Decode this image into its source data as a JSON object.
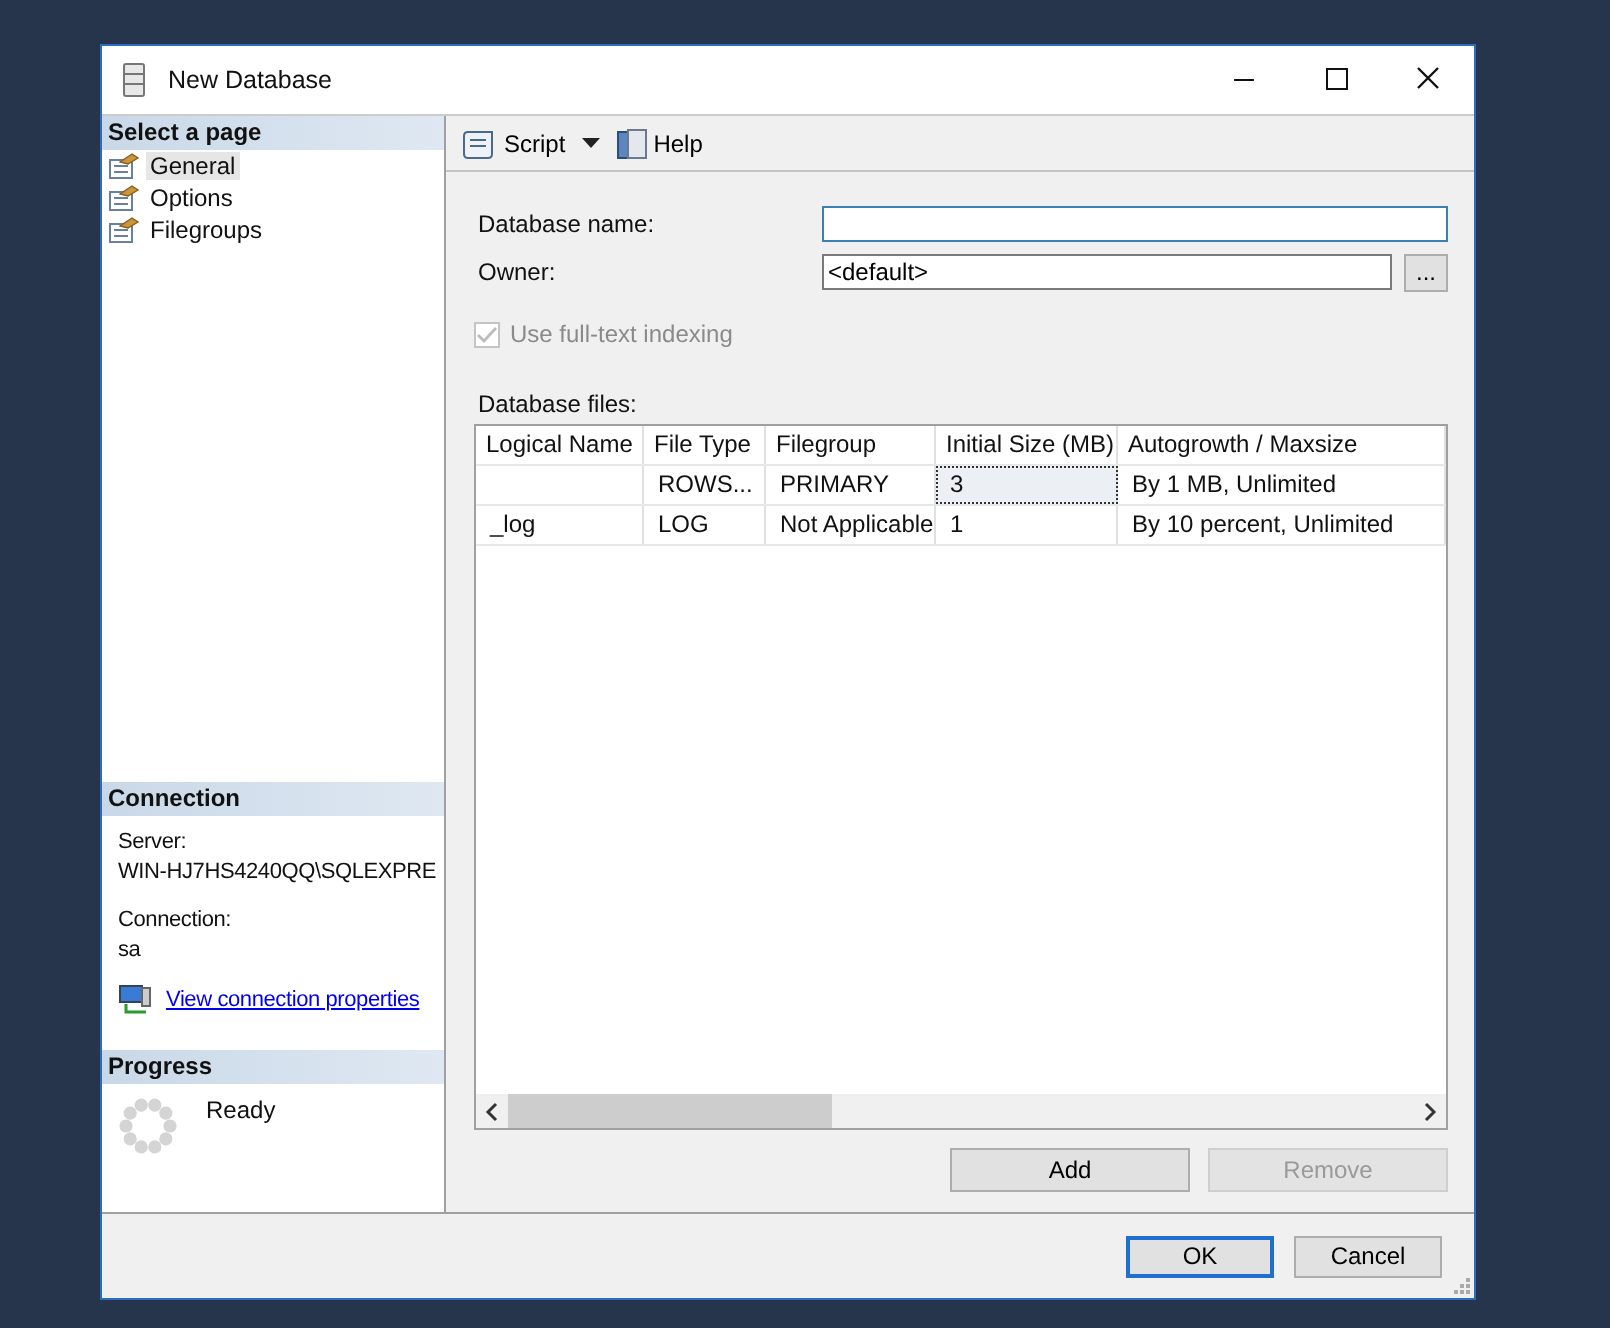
{
  "window": {
    "title": "New Database"
  },
  "sidebar": {
    "heading": "Select a page",
    "items": [
      {
        "label": "General",
        "selected": true
      },
      {
        "label": "Options",
        "selected": false
      },
      {
        "label": "Filegroups",
        "selected": false
      }
    ]
  },
  "connection": {
    "heading": "Connection",
    "server_label": "Server:",
    "server": "WIN-HJ7HS4240QQ\\SQLEXPRE",
    "connection_label": "Connection:",
    "connection": "sa",
    "link": "View connection properties"
  },
  "progress": {
    "heading": "Progress",
    "status": "Ready"
  },
  "toolbar": {
    "items": [
      {
        "label": "Script",
        "kind": "script"
      },
      {
        "label": "Help",
        "kind": "help"
      }
    ]
  },
  "form": {
    "name_label": "Database name:",
    "name_focused": true,
    "owner_label": "Owner:",
    "owner_value": "<default>",
    "browse": "...",
    "fulltext": {
      "label": "Use full-text indexing",
      "checked": true,
      "disabled": true
    }
  },
  "files": {
    "label": "Database files:",
    "columns": [
      "Logical Name",
      "File Type",
      "Filegroup",
      "Initial Size (MB)",
      "Autogrowth / Maxsize"
    ],
    "rows": [
      {
        "cells": [
          {
            "selected": false
          },
          {
            "text": "ROWS...",
            "selected": false
          },
          {
            "text": "PRIMARY",
            "selected": false
          },
          {
            "text": "3",
            "selected": true
          },
          {
            "text": "By 1 MB, Unlimited",
            "selected": false
          }
        ]
      },
      {
        "cells": [
          {
            "text": "_log",
            "selected": false
          },
          {
            "text": "LOG",
            "selected": false
          },
          {
            "text": "Not Applicable",
            "selected": false
          },
          {
            "text": "1",
            "selected": false
          },
          {
            "text": "By 10 percent, Unlimited",
            "selected": false
          }
        ]
      }
    ]
  },
  "file_buttons": [
    {
      "label": "Add",
      "disabled": false
    },
    {
      "label": "Remove",
      "disabled": true
    }
  ],
  "dialog_buttons": [
    {
      "label": "OK",
      "default": true
    },
    {
      "label": "Cancel",
      "default": false
    }
  ]
}
